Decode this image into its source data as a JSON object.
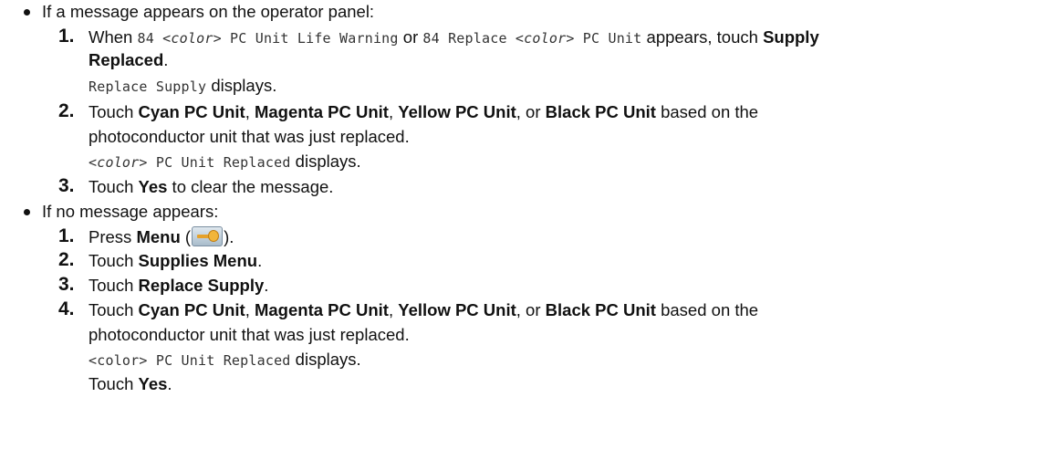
{
  "section1": {
    "bullet": "If a message appears on the operator panel:",
    "steps": [
      {
        "num": "1.",
        "pre": "When ",
        "msg1_a": "84 <",
        "msg1_b": "color",
        "msg1_c": "> PC Unit Life Warning",
        "or": " or ",
        "msg2_a": "84 Replace <",
        "msg2_b": "color",
        "msg2_c": "> PC Unit",
        "post": " appears, touch ",
        "bold": "Supply",
        "bold2": "Replaced",
        "bold2_end": ".",
        "sub_mono": "Replace Supply",
        "sub_text": " displays."
      },
      {
        "num": "2.",
        "pre": "Touch ",
        "cyan": "Cyan PC Unit",
        "sep1": ", ",
        "magenta": "Magenta PC Unit",
        "sep2": ", ",
        "yellow": "Yellow PC Unit",
        "sep3": ", or ",
        "black": "Black PC Unit",
        "post": " based on the",
        "line2": "photoconductor unit that was just replaced.",
        "sub_mono_a": "<",
        "sub_mono_b": "color",
        "sub_mono_c": "> PC Unit Replaced",
        "sub_text": " displays."
      },
      {
        "num": "3.",
        "pre": "Touch ",
        "bold": "Yes",
        "post": " to clear the message."
      }
    ]
  },
  "section2": {
    "bullet": "If no message appears:",
    "steps": [
      {
        "num": "1.",
        "pre": "Press ",
        "bold": "Menu",
        "open": " (",
        "close": ")."
      },
      {
        "num": "2.",
        "pre": "Touch ",
        "bold": "Supplies Menu",
        "post": "."
      },
      {
        "num": "3.",
        "pre": "Touch ",
        "bold": "Replace Supply",
        "post": "."
      },
      {
        "num": "4.",
        "pre": "Touch ",
        "cyan": "Cyan PC Unit",
        "sep1": ", ",
        "magenta": "Magenta PC Unit",
        "sep2": ", ",
        "yellow": "Yellow PC Unit",
        "sep3": ", or ",
        "black": "Black PC Unit",
        "post": " based on the",
        "line2": "photoconductor unit that was just replaced.",
        "sub_mono": "<color> PC Unit Replaced",
        "sub_text": " displays.",
        "final_pre": "Touch ",
        "final_bold": "Yes",
        "final_post": "."
      }
    ]
  },
  "icons": {
    "menu_key": "key-menu-icon"
  }
}
